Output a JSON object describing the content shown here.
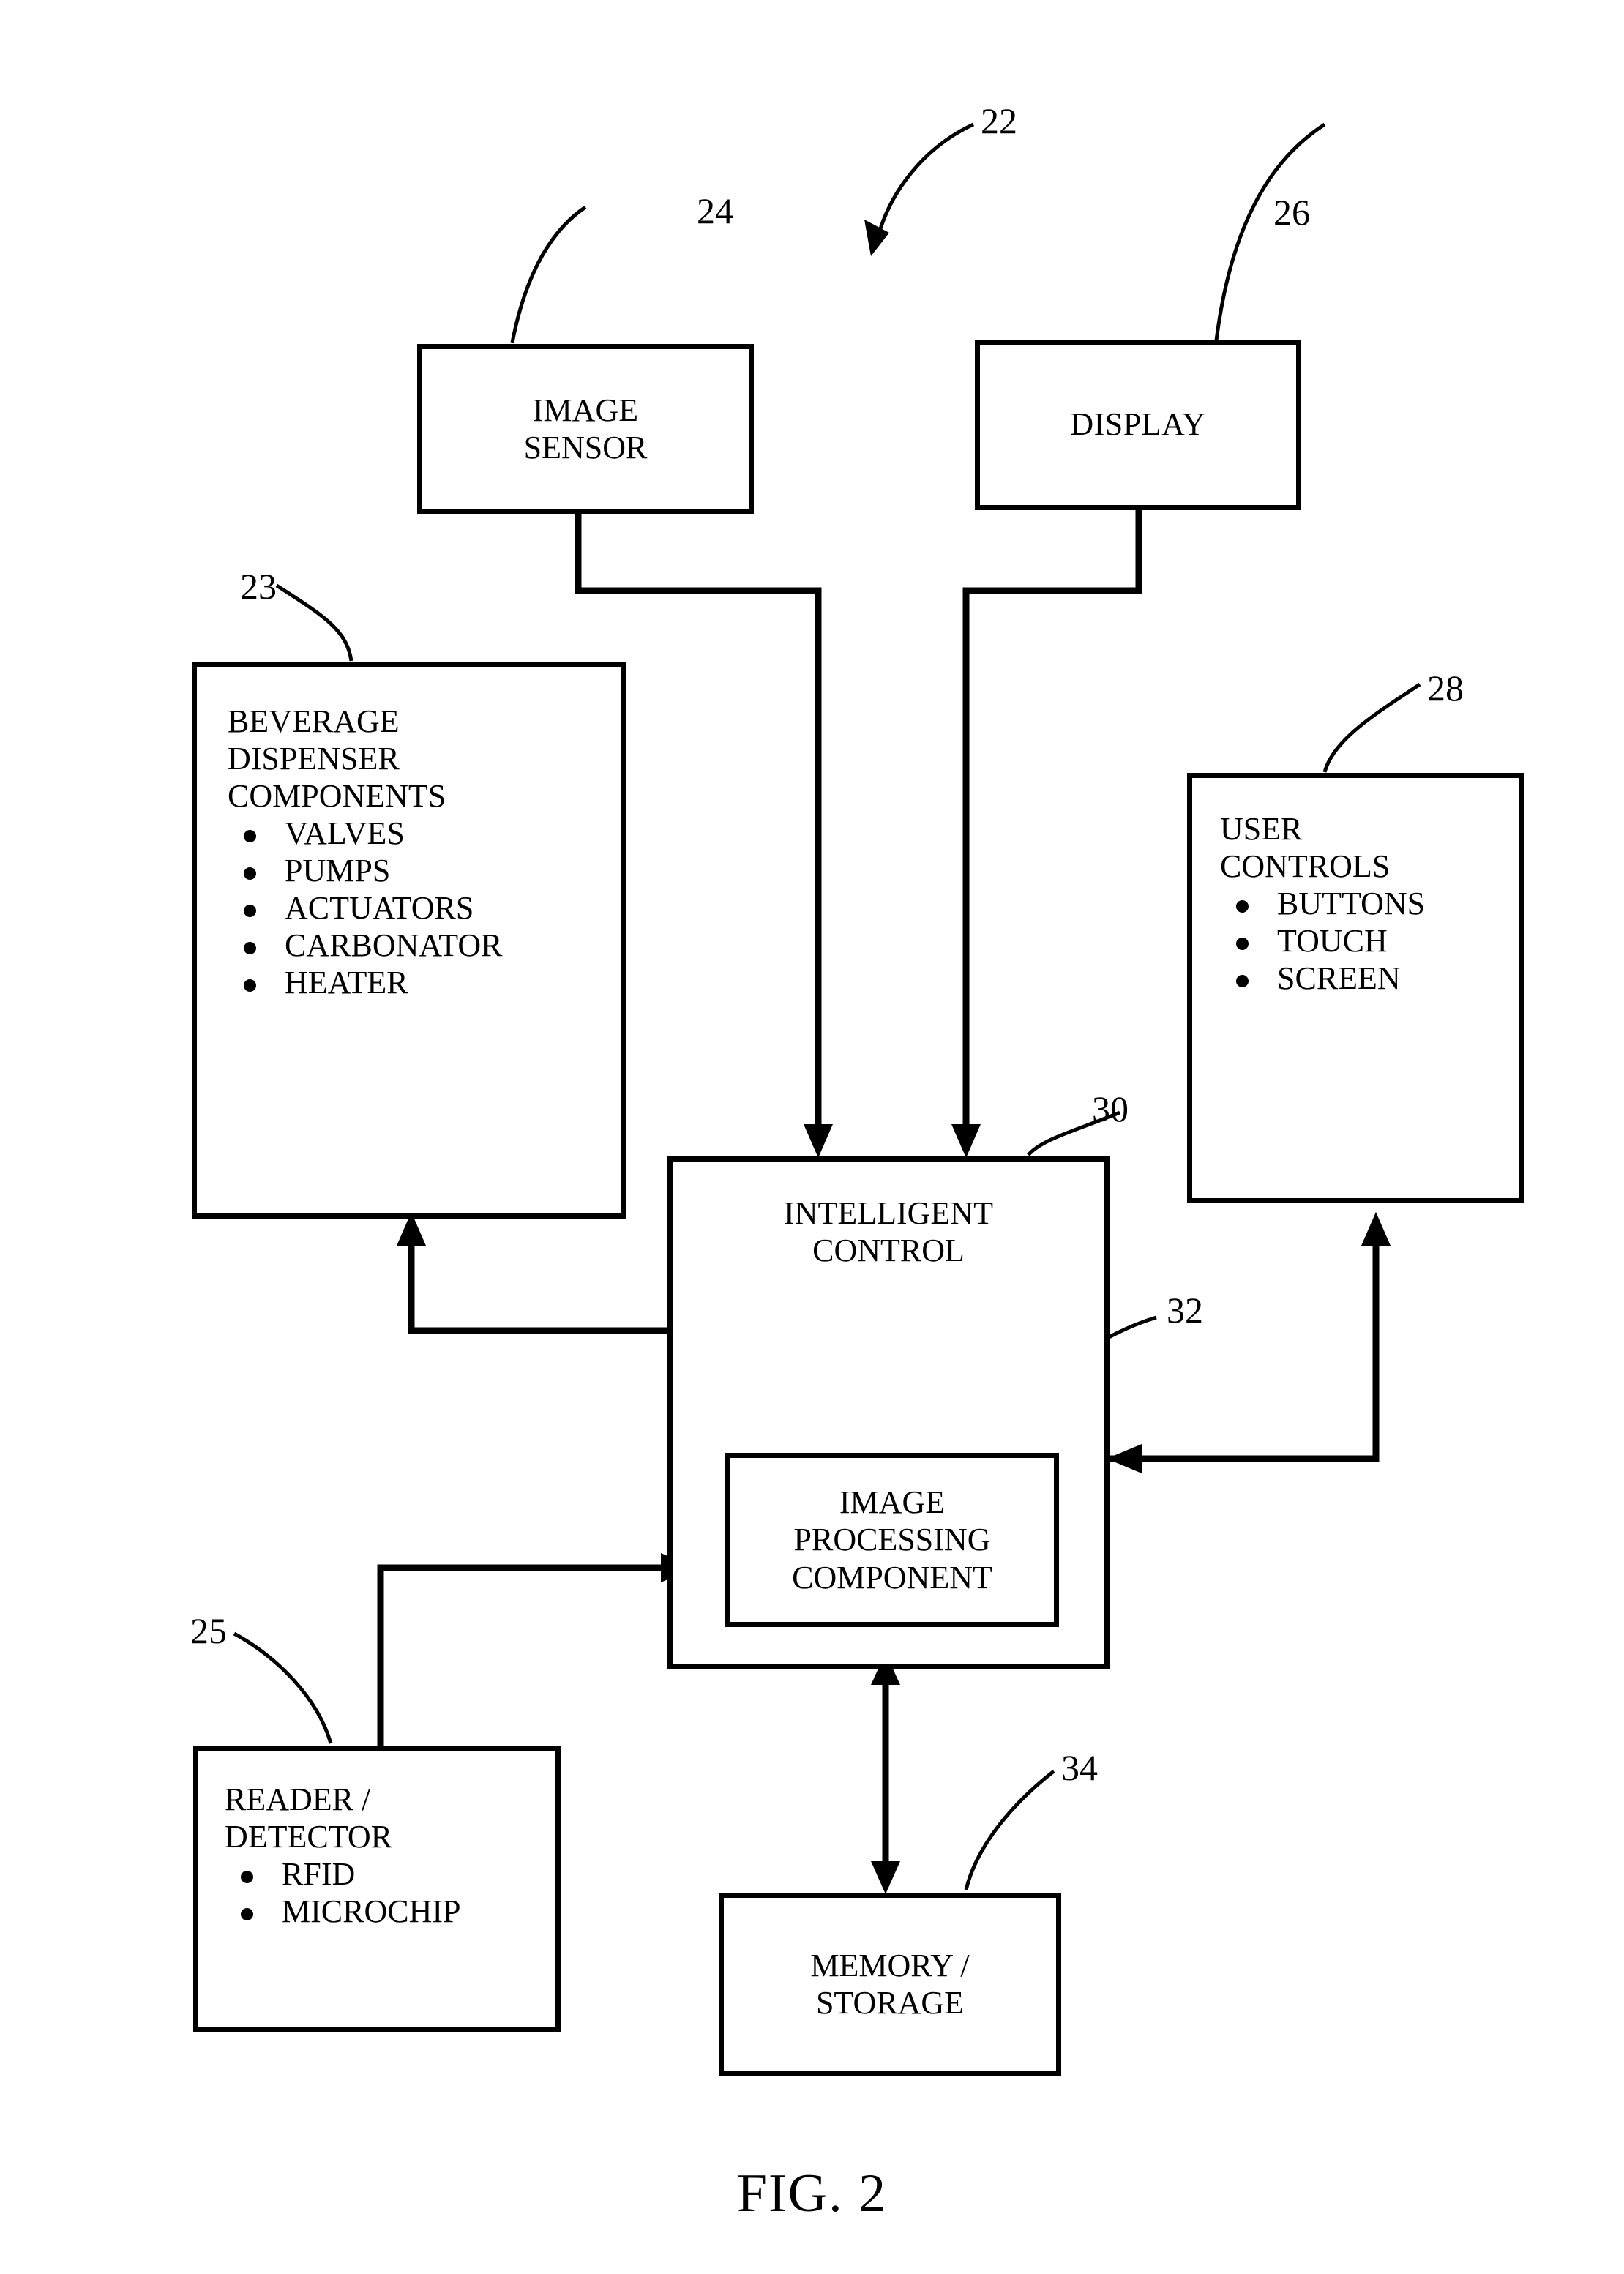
{
  "figure": {
    "caption": "FIG. 2",
    "system_ref": "22"
  },
  "blocks": {
    "image_sensor": {
      "ref": "24",
      "title_line1": "IMAGE",
      "title_line2": "SENSOR"
    },
    "display": {
      "ref": "26",
      "title": "DISPLAY"
    },
    "beverage_dispenser": {
      "ref": "23",
      "title_line1": "BEVERAGE",
      "title_line2": "DISPENSER",
      "title_line3": "COMPONENTS",
      "items": [
        "VALVES",
        "PUMPS",
        "ACTUATORS",
        "CARBONATOR",
        "HEATER"
      ]
    },
    "user_controls": {
      "ref": "28",
      "title_line1": "USER",
      "title_line2": "CONTROLS",
      "items": [
        "BUTTONS",
        "TOUCH",
        "SCREEN"
      ]
    },
    "intelligent_control": {
      "ref": "30",
      "title_line1": "INTELLIGENT",
      "title_line2": "CONTROL"
    },
    "image_processing_component": {
      "ref": "32",
      "title_line1": "IMAGE",
      "title_line2": "PROCESSING",
      "title_line3": "COMPONENT"
    },
    "reader_detector": {
      "ref": "25",
      "title_line1": "READER /",
      "title_line2": "DETECTOR",
      "items": [
        "RFID",
        "MICROCHIP"
      ]
    },
    "memory_storage": {
      "ref": "34",
      "title_line1": "MEMORY /",
      "title_line2": "STORAGE"
    }
  },
  "colors": {
    "stroke": "#000000",
    "background": "#ffffff"
  }
}
